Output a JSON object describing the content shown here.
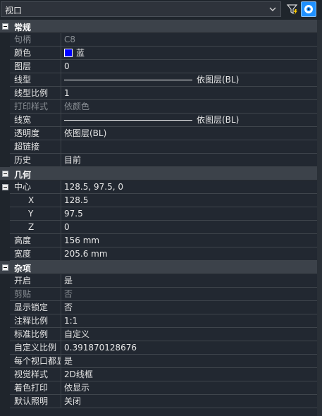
{
  "toolbar": {
    "selected_object": "视口",
    "icons": {
      "dropdown": "chevron-down-icon",
      "filter": "quick-select-filter-icon",
      "toggle": "pickadd-eye-icon"
    },
    "accent": "#1e90ff"
  },
  "sections": [
    {
      "title": "常规",
      "rows": [
        {
          "key": "句柄",
          "value": "C8",
          "dim": true
        },
        {
          "key": "颜色",
          "value": "蓝",
          "swatch": "#0000ff"
        },
        {
          "key": "图层",
          "value": "0"
        },
        {
          "key": "线型",
          "value": "依图层(BL)",
          "line": true
        },
        {
          "key": "线型比例",
          "value": "1"
        },
        {
          "key": "打印样式",
          "value": "依颜色",
          "dim": true
        },
        {
          "key": "线宽",
          "value": "依图层(BL)",
          "line": true
        },
        {
          "key": "透明度",
          "value": "依图层(BL)"
        },
        {
          "key": "超链接",
          "value": ""
        },
        {
          "key": "历史",
          "value": "目前"
        }
      ]
    },
    {
      "title": "几何",
      "rows": [
        {
          "key": "中心",
          "value": "128.5, 97.5, 0",
          "collapsible": true
        },
        {
          "key": "X",
          "value": "128.5",
          "sub": true
        },
        {
          "key": "Y",
          "value": "97.5",
          "sub": true
        },
        {
          "key": "Z",
          "value": "0",
          "sub": true
        },
        {
          "key": "高度",
          "value": "156 mm"
        },
        {
          "key": "宽度",
          "value": "205.6 mm"
        }
      ]
    },
    {
      "title": "杂项",
      "rows": [
        {
          "key": "开启",
          "value": "是"
        },
        {
          "key": "剪贴",
          "value": "否",
          "dim": true
        },
        {
          "key": "显示锁定",
          "value": "否"
        },
        {
          "key": "注释比例",
          "value": "1:1"
        },
        {
          "key": "标准比例",
          "value": "自定义"
        },
        {
          "key": "自定义比例",
          "value": "0.391870128676"
        },
        {
          "key": "每个视口都显示UCS",
          "value": "是"
        },
        {
          "key": "视觉样式",
          "value": "2D线框"
        },
        {
          "key": "着色打印",
          "value": "依显示"
        },
        {
          "key": "默认照明",
          "value": "关闭"
        }
      ]
    }
  ]
}
